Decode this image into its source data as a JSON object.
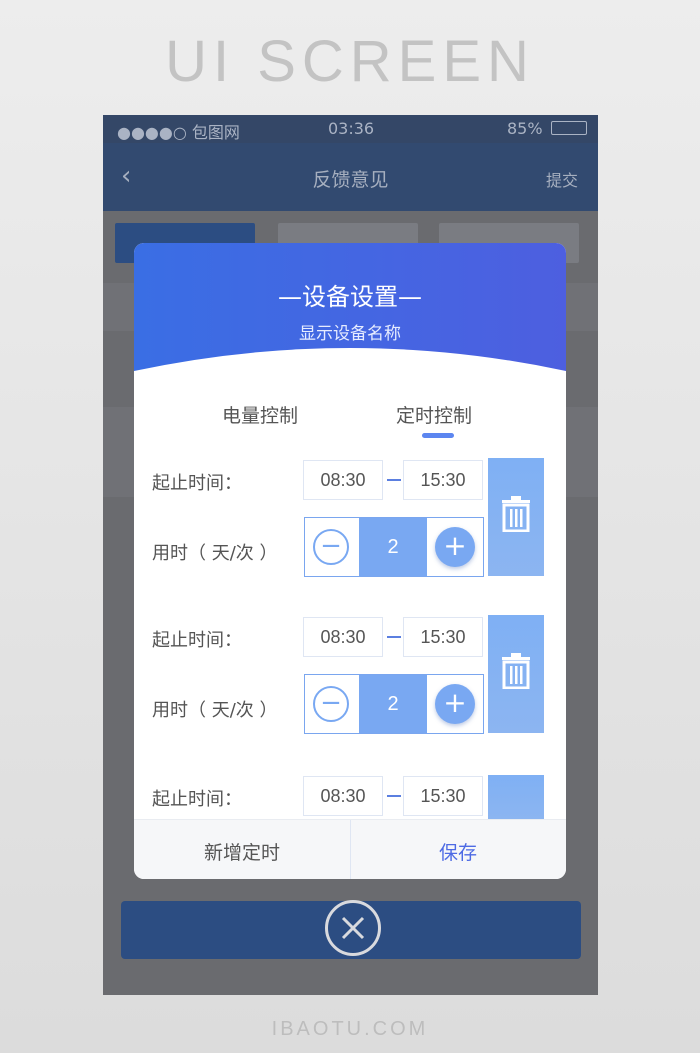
{
  "page": {
    "heading": "UI SCREEN",
    "footer": "IBAOTU.COM"
  },
  "status_bar": {
    "carrier": "●●●●○ 包图网",
    "time": "03:36",
    "battery": "85%"
  },
  "nav": {
    "back": "‹",
    "title": "反馈意见",
    "submit": "提交"
  },
  "dialog": {
    "title": "—设备设置—",
    "subtitle": "显示设备名称",
    "tabs": [
      {
        "label": "电量控制",
        "active": false
      },
      {
        "label": "定时控制",
        "active": true
      }
    ],
    "schedules": [
      {
        "time_label": "起止时间：",
        "start": "08:30",
        "end": "15:30",
        "duration_label": "用时（ 天/次 ）",
        "count": "2"
      },
      {
        "time_label": "起止时间：",
        "start": "08:30",
        "end": "15:30",
        "duration_label": "用时（ 天/次 ）",
        "count": "2"
      },
      {
        "time_label": "起止时间：",
        "start": "08:30",
        "end": "15:30"
      }
    ],
    "footer": {
      "add": "新增定时",
      "save": "保存"
    }
  },
  "colors": {
    "accent": "#4d6ae4",
    "button_light": "#79a8f2",
    "nav_bg": "#324a70"
  },
  "icons": [
    "back-arrow-icon",
    "minus-icon",
    "plus-icon",
    "trash-icon",
    "close-icon"
  ]
}
